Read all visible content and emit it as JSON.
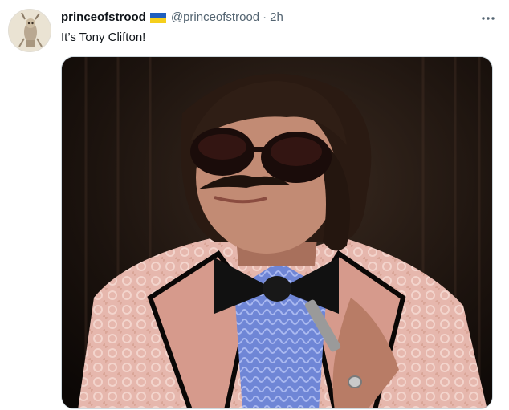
{
  "tweet": {
    "display_name": "princeofstrood",
    "handle": "@princeofstrood",
    "separator": "·",
    "time": "2h",
    "text": "It’s Tony Clifton!"
  },
  "icons": {
    "avatar": "avatar-image",
    "flag": "ukraine-flag-emoji",
    "more": "more-options-icon"
  },
  "colors": {
    "text_primary": "#0f1419",
    "text_secondary": "#536471",
    "media_border": "#cfd9de",
    "flag_blue": "#1f5fbf",
    "flag_yellow": "#f5cf1c"
  }
}
